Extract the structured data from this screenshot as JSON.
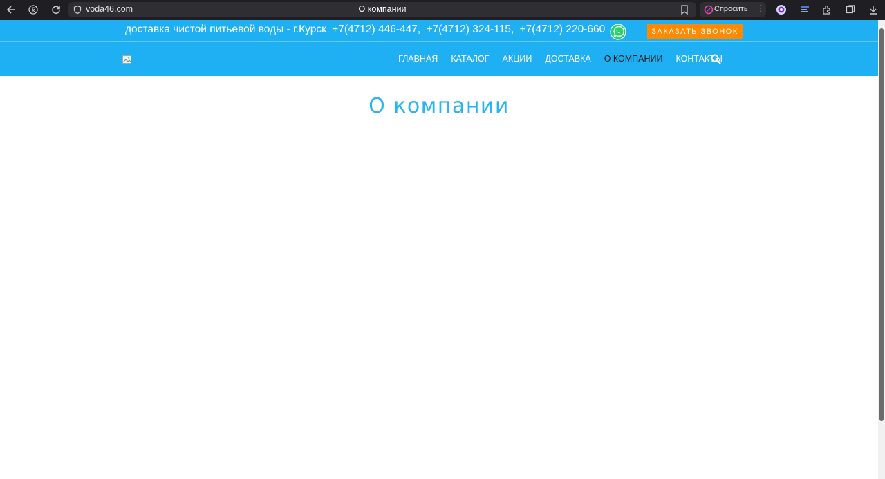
{
  "browser": {
    "url": "voda46.com",
    "page_title": "О компании",
    "ask_label": "Спросить",
    "more_glyph": "⋮"
  },
  "topbar": {
    "delivery_text": "доставка чистой питьевой воды  - г.Курск",
    "phone1": "+7(4712) 446-447,",
    "phone2": "+7(4712) 324-115,",
    "phone3": "+7(4712) 220-660",
    "call_button": "ЗАКАЗАТЬ ЗВОНОК"
  },
  "nav": {
    "items": [
      {
        "label": "ГЛАВНАЯ"
      },
      {
        "label": "КАТАЛОГ"
      },
      {
        "label": "АКЦИИ"
      },
      {
        "label": "ДОСТАВКА"
      },
      {
        "label": "О КОМПАНИИ",
        "active": true
      },
      {
        "label": "КОНТАКТЫ"
      }
    ]
  },
  "main": {
    "heading": "О компании"
  },
  "colors": {
    "brand_blue": "#1eb0f2",
    "heading_blue": "#29b5f2",
    "call_orange": "#ff8a00",
    "whatsapp_green": "#25d366"
  },
  "icons": [
    "back-icon",
    "yandex-icon",
    "reload-icon",
    "shield-icon",
    "bookmark-icon",
    "alice-icon",
    "extension-icon",
    "collections-icon",
    "download-icon",
    "whatsapp-icon",
    "broken-image-icon",
    "search-icon"
  ]
}
